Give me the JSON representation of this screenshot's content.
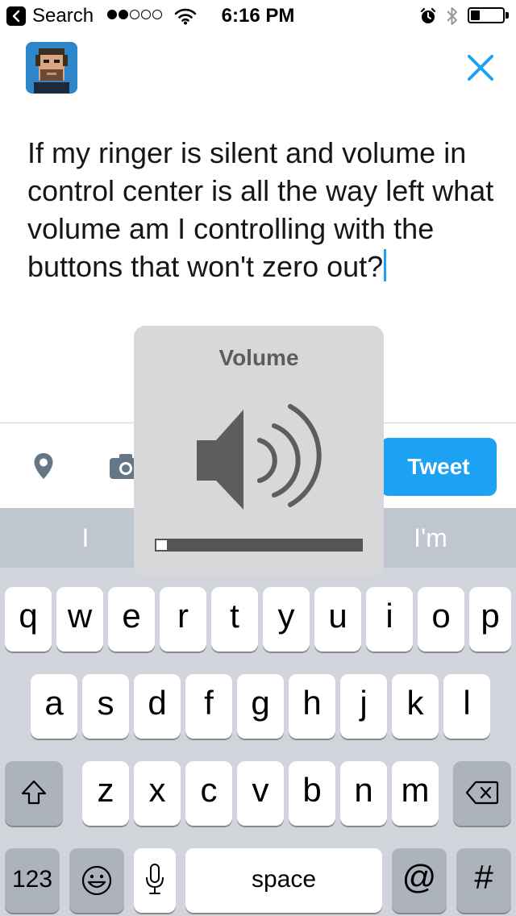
{
  "status_bar": {
    "back_label": "Search",
    "signal_bars": 2,
    "signal_total": 5,
    "time": "6:16 PM",
    "battery_level": 0.3
  },
  "compose": {
    "text": "If my ringer is silent and volume in control center is all the way left what volume am I controlling with the buttons that won't zero out?"
  },
  "toolbar": {
    "location_icon": "location-pin-icon",
    "camera_icon": "camera-icon",
    "tweet_label": "Tweet"
  },
  "predictions": [
    "I",
    "",
    "I'm"
  ],
  "keyboard": {
    "row1": [
      "q",
      "w",
      "e",
      "r",
      "t",
      "y",
      "u",
      "i",
      "o",
      "p"
    ],
    "row2": [
      "a",
      "s",
      "d",
      "f",
      "g",
      "h",
      "j",
      "k",
      "l"
    ],
    "row3": [
      "z",
      "x",
      "c",
      "v",
      "b",
      "n",
      "m"
    ],
    "numbers_label": "123",
    "space_label": "space",
    "at_label": "@",
    "hash_label": "#"
  },
  "volume_hud": {
    "title": "Volume",
    "level": 0.05
  },
  "colors": {
    "accent": "#1da1f2",
    "keyboard_bg": "#d1d5db",
    "hud_bg": "#d8d8db"
  }
}
